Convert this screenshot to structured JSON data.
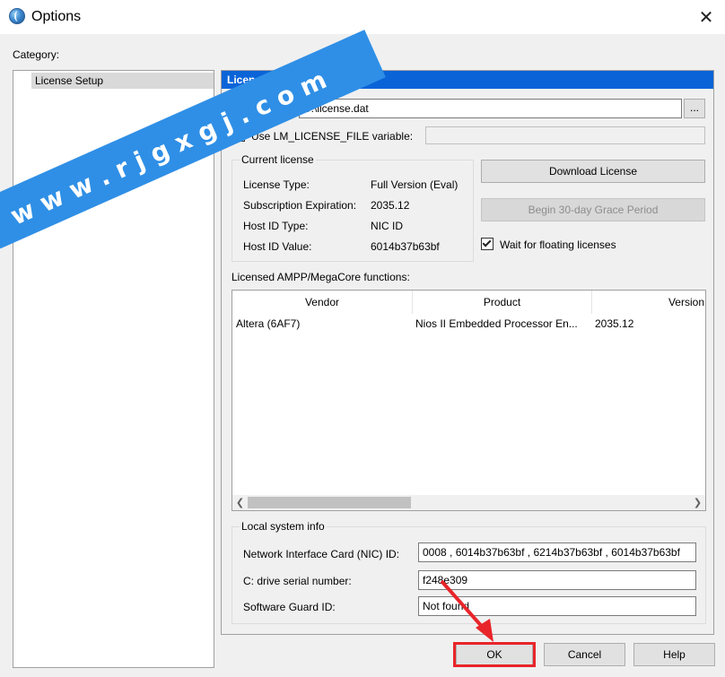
{
  "window": {
    "title": "Options",
    "close_glyph": "✕"
  },
  "category": {
    "label": "Category:",
    "items": [
      {
        "label": "License Setup",
        "selected": true
      }
    ]
  },
  "panel": {
    "header": "License Setup",
    "license_file": {
      "label": "License file:",
      "value": "D:\\license.dat",
      "browse_label": "..."
    },
    "lm_license": {
      "label": "Use LM_LICENSE_FILE variable:",
      "checked": false,
      "value": ""
    },
    "current_license": {
      "title": "Current license",
      "rows": [
        {
          "label": "License Type:",
          "value": "Full Version (Eval)"
        },
        {
          "label": "Subscription Expiration:",
          "value": "2035.12"
        },
        {
          "label": "Host ID Type:",
          "value": "NIC ID"
        },
        {
          "label": "Host ID Value:",
          "value": "6014b37b63bf"
        }
      ]
    },
    "download_license_label": "Download License",
    "grace_period_label": "Begin 30-day Grace Period",
    "floating": {
      "label": "Wait for floating licenses",
      "checked": true
    },
    "functions": {
      "title": "Licensed AMPP/MegaCore functions:",
      "columns": [
        "Vendor",
        "Product",
        "Version"
      ],
      "rows": [
        {
          "vendor": "Altera (6AF7)",
          "product": "Nios II Embedded Processor En...",
          "version": "2035.12"
        }
      ]
    },
    "local_info": {
      "title": "Local system info",
      "rows": [
        {
          "label": "Network Interface Card (NIC) ID:",
          "value": "0008 , 6014b37b63bf , 6214b37b63bf , 6014b37b63bf"
        },
        {
          "label": "C: drive serial number:",
          "value": "f248e309"
        },
        {
          "label": "Software Guard ID:",
          "value": "Not found"
        }
      ]
    }
  },
  "footer": {
    "ok_label": "OK",
    "cancel_label": "Cancel",
    "help_label": "Help"
  },
  "watermark": {
    "text": "w w w . r j g x g j . c o m",
    "color": "#2f8fe6"
  },
  "colors": {
    "header_blue": "#0a64d8",
    "highlight_red": "#e8252a"
  }
}
